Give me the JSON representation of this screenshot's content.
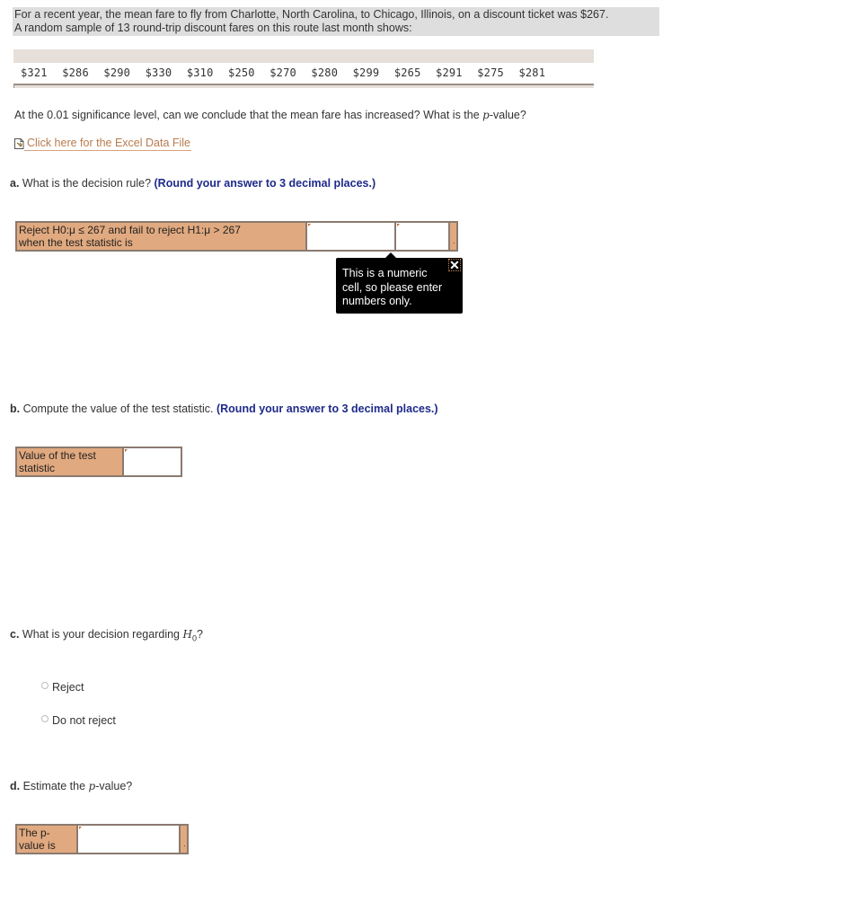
{
  "intro": {
    "line1": "For a recent year, the mean fare to fly from Charlotte, North Carolina, to Chicago, Illinois, on a discount ticket was $267.",
    "line2": "A random sample of 13 round-trip discount fares on this route last month shows:"
  },
  "fares": [
    "$321",
    "$286",
    "$290",
    "$330",
    "$310",
    "$250",
    "$270",
    "$280",
    "$299",
    "$265",
    "$291",
    "$275",
    "$281"
  ],
  "question": {
    "before": "At the 0.01 significance level, can we conclude that the mean fare has increased? What is the ",
    "p": "p",
    "after": "-value?"
  },
  "excel_link": "Click here for the Excel Data File",
  "part_a": {
    "letter": "a.",
    "text": " What is the decision rule? ",
    "hint": "(Round your answer to 3 decimal places.)",
    "row_label_line1": "Reject H0:μ ≤ 267 and fail to reject H1:μ > 267",
    "row_label_line2": "when the test statistic is",
    "cell1_value": "",
    "cell2_value": "",
    "tail": "."
  },
  "tooltip": {
    "line1": "This is a numeric",
    "line2": "cell, so please enter",
    "line3": "numbers only.",
    "close": "✕"
  },
  "part_b": {
    "letter": "b.",
    "text": " Compute the value of the test statistic. ",
    "hint": "(Round your answer to 3 decimal places.)",
    "label_line1": "Value of the test",
    "label_line2": "statistic",
    "value": ""
  },
  "part_c": {
    "letter": "c.",
    "text": " What is your decision regarding ",
    "h": "H",
    "sub": "0",
    "qmark": "?",
    "options": [
      "Reject",
      "Do not reject"
    ]
  },
  "part_d": {
    "letter": "d.",
    "text": " Estimate the ",
    "p": "p",
    "after": "-value?",
    "label_line1": "The p-",
    "label_line2": "value is",
    "value": "",
    "tail": "."
  }
}
